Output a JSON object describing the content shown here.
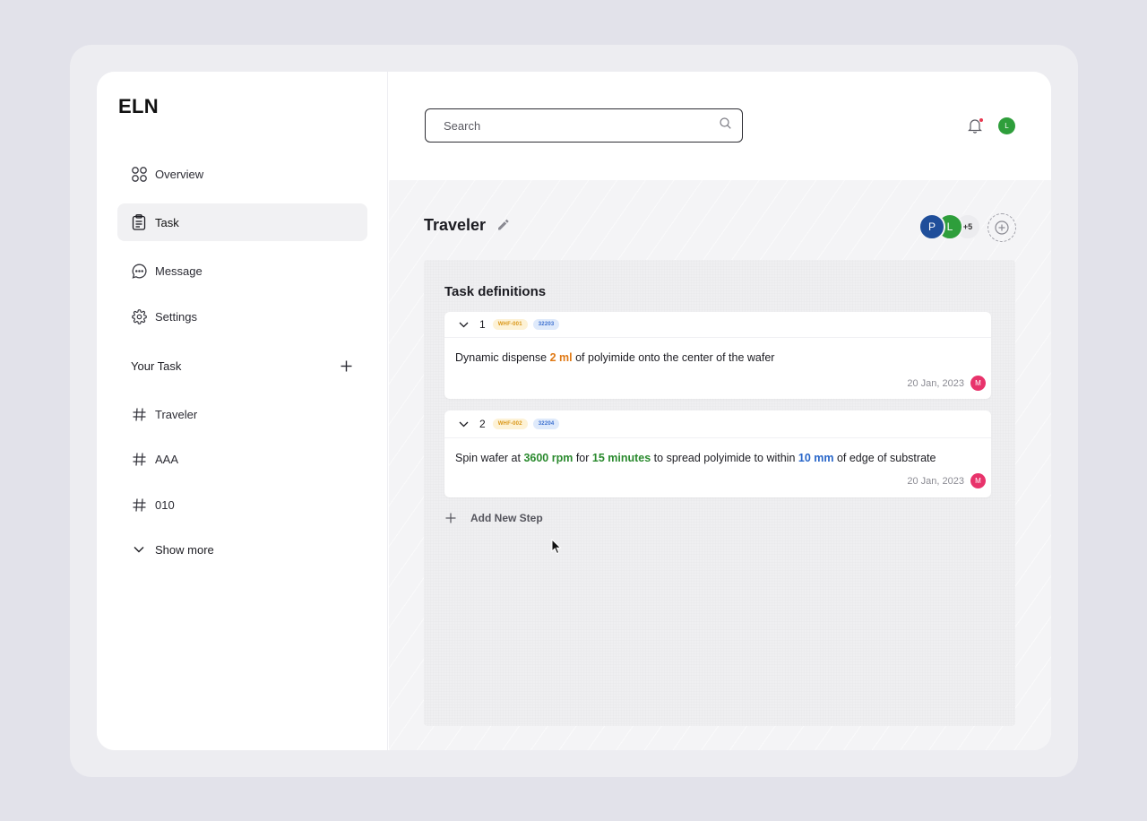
{
  "app": {
    "logo": "ELN"
  },
  "sidebar": {
    "nav": [
      {
        "label": "Overview",
        "icon": "grid-icon",
        "active": false
      },
      {
        "label": "Task",
        "icon": "clipboard-icon",
        "active": true
      },
      {
        "label": "Message",
        "icon": "chat-icon",
        "active": false
      },
      {
        "label": "Settings",
        "icon": "gear-icon",
        "active": false
      }
    ],
    "your_task_title": "Your Task",
    "tasks": [
      {
        "label": "Traveler",
        "icon": "hash-icon"
      },
      {
        "label": "AAA",
        "icon": "hash-icon"
      },
      {
        "label": "010",
        "icon": "hash-icon"
      }
    ],
    "show_more": "Show more"
  },
  "header": {
    "search_placeholder": "Search",
    "user_initial": "L"
  },
  "page": {
    "title": "Traveler",
    "members": [
      {
        "initial": "P",
        "color": "#1f4e9a"
      },
      {
        "initial": "L",
        "color": "#2e9e3b"
      }
    ],
    "members_more": "+5"
  },
  "panel": {
    "title": "Task definitions",
    "steps": [
      {
        "number": "1",
        "tags": [
          "WHF-001",
          "32203"
        ],
        "text": {
          "p1": "Dynamic dispense ",
          "h1": "2 ml",
          "p2": " of polyimide onto the center of the wafer"
        },
        "date": "20 Jan, 2023",
        "author_initial": "M"
      },
      {
        "number": "2",
        "tags": [
          "WHF-002",
          "32204"
        ],
        "text": {
          "p1": "Spin wafer at ",
          "h1": "3600 rpm",
          "p2": " for ",
          "h2": "15 minutes",
          "p3": " to spread polyimide to within ",
          "h3": "10 mm",
          "p4": " of edge of substrate"
        },
        "date": "20 Jan, 2023",
        "author_initial": "M"
      }
    ],
    "add_step_label": "Add New Step"
  },
  "colors": {
    "accent_green": "#2a8a2e",
    "accent_orange": "#e07a16",
    "accent_blue": "#2866c9",
    "notification_dot": "#e8384f",
    "author_avatar": "#e8336b"
  }
}
